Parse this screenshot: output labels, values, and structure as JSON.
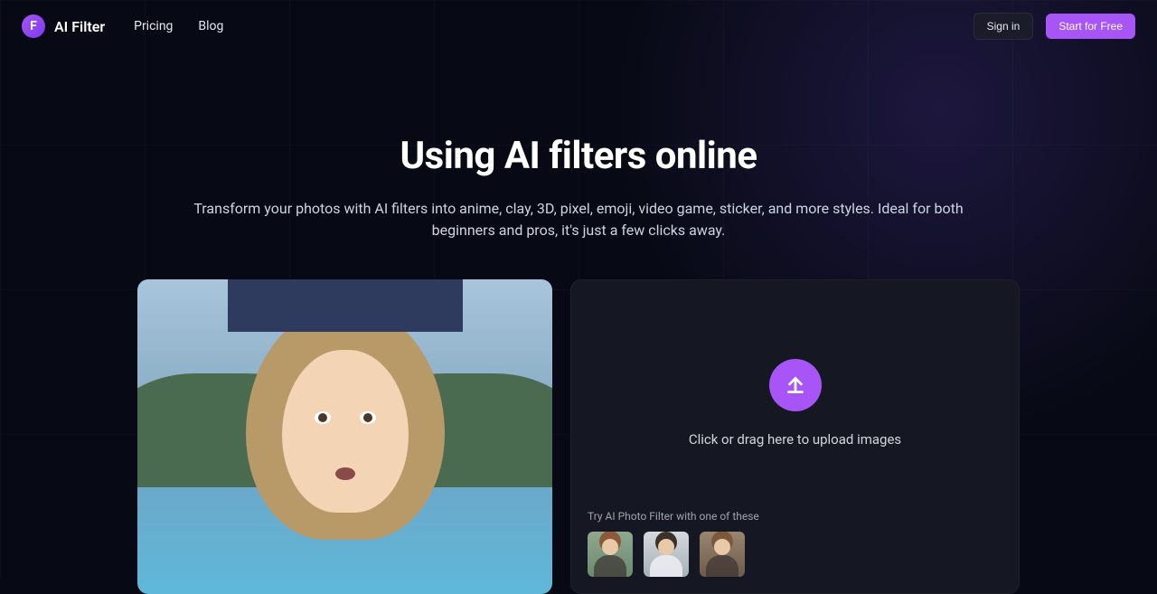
{
  "brand": {
    "name": "AI Filter",
    "logo_letter": "F"
  },
  "nav": {
    "pricing": "Pricing",
    "blog": "Blog"
  },
  "auth": {
    "signin": "Sign in",
    "start": "Start for Free"
  },
  "hero": {
    "title": "Using AI filters online",
    "subtitle": "Transform your photos with AI filters into anime, clay, 3D, pixel, emoji, video game, sticker, and more styles. Ideal for both beginners and pros, it's just a few clicks away."
  },
  "upload": {
    "drop_text": "Click or drag here to upload images",
    "try_label": "Try AI Photo Filter with one of these"
  },
  "colors": {
    "accent": "#a855f7",
    "bg": "#070a14",
    "panel": "#151822"
  }
}
